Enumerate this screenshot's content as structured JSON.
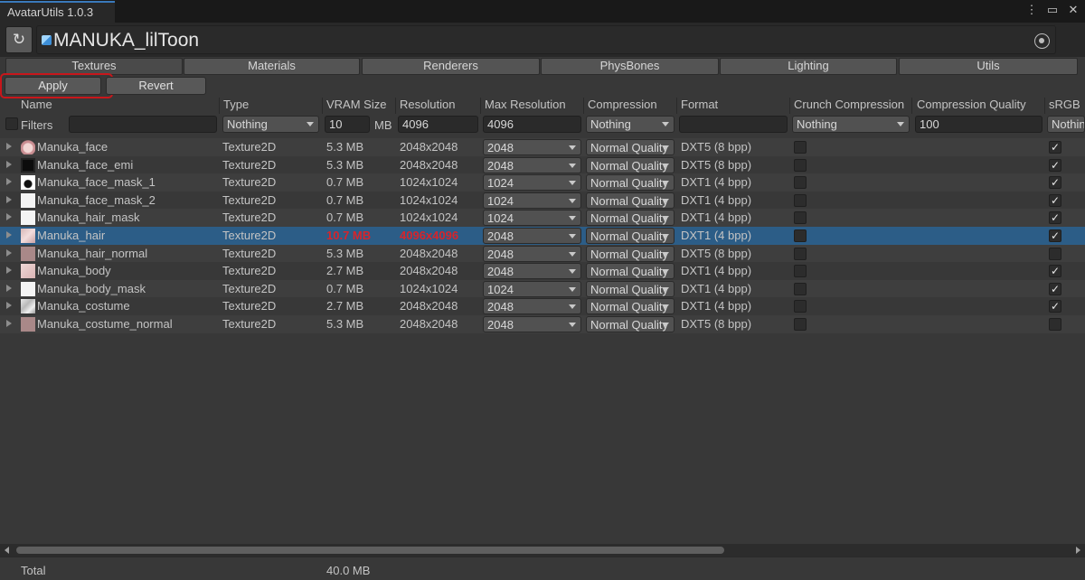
{
  "window": {
    "title": "AvatarUtils 1.0.3"
  },
  "avatar": {
    "name": "MANUKA_lilToon"
  },
  "tabs": [
    "Textures",
    "Materials",
    "Renderers",
    "PhysBones",
    "Lighting",
    "Utils"
  ],
  "actions": {
    "apply": "Apply",
    "revert": "Revert"
  },
  "columns": [
    "Name",
    "Type",
    "VRAM Size",
    "Resolution",
    "Max Resolution",
    "Compression",
    "Format",
    "Crunch Compression",
    "Compression Quality",
    "sRGB"
  ],
  "filters": {
    "label": "Filters",
    "name": "",
    "type": "Nothing",
    "vram": "10",
    "vram_unit": "MB",
    "resolution": "4096",
    "max_resolution": "4096",
    "compression": "Nothing",
    "format": "",
    "crunch": "Nothing",
    "quality": "100",
    "srgb": "Nothing"
  },
  "textures": [
    {
      "name": "Manuka_face",
      "type": "Texture2D",
      "vram": "5.3 MB",
      "resolution": "2048x2048",
      "max_resolution": "2048",
      "compression": "Normal Quality",
      "format": "DXT5 (8 bpp)",
      "crunch": false,
      "srgb": true,
      "thumb": "face"
    },
    {
      "name": "Manuka_face_emi",
      "type": "Texture2D",
      "vram": "5.3 MB",
      "resolution": "2048x2048",
      "max_resolution": "2048",
      "compression": "Normal Quality",
      "format": "DXT5 (8 bpp)",
      "crunch": false,
      "srgb": true,
      "thumb": "dark"
    },
    {
      "name": "Manuka_face_mask_1",
      "type": "Texture2D",
      "vram": "0.7 MB",
      "resolution": "1024x1024",
      "max_resolution": "1024",
      "compression": "Normal Quality",
      "format": "DXT1 (4 bpp)",
      "crunch": false,
      "srgb": true,
      "thumb": "mask"
    },
    {
      "name": "Manuka_face_mask_2",
      "type": "Texture2D",
      "vram": "0.7 MB",
      "resolution": "1024x1024",
      "max_resolution": "1024",
      "compression": "Normal Quality",
      "format": "DXT1 (4 bpp)",
      "crunch": false,
      "srgb": true,
      "thumb": "white"
    },
    {
      "name": "Manuka_hair_mask",
      "type": "Texture2D",
      "vram": "0.7 MB",
      "resolution": "1024x1024",
      "max_resolution": "1024",
      "compression": "Normal Quality",
      "format": "DXT1 (4 bpp)",
      "crunch": false,
      "srgb": true,
      "thumb": "white"
    },
    {
      "name": "Manuka_hair",
      "type": "Texture2D",
      "vram": "10.7 MB",
      "resolution": "4096x4096",
      "max_resolution": "2048",
      "compression": "Normal Quality",
      "format": "DXT1 (4 bpp)",
      "crunch": false,
      "srgb": true,
      "thumb": "pink",
      "warning": true,
      "selected": true
    },
    {
      "name": "Manuka_hair_normal",
      "type": "Texture2D",
      "vram": "5.3 MB",
      "resolution": "2048x2048",
      "max_resolution": "2048",
      "compression": "Normal Quality",
      "format": "DXT5 (8 bpp)",
      "crunch": false,
      "srgb": false,
      "thumb": "mauve"
    },
    {
      "name": "Manuka_body",
      "type": "Texture2D",
      "vram": "2.7 MB",
      "resolution": "2048x2048",
      "max_resolution": "2048",
      "compression": "Normal Quality",
      "format": "DXT1 (4 bpp)",
      "crunch": false,
      "srgb": true,
      "thumb": "skin"
    },
    {
      "name": "Manuka_body_mask",
      "type": "Texture2D",
      "vram": "0.7 MB",
      "resolution": "1024x1024",
      "max_resolution": "1024",
      "compression": "Normal Quality",
      "format": "DXT1 (4 bpp)",
      "crunch": false,
      "srgb": true,
      "thumb": "white"
    },
    {
      "name": "Manuka_costume",
      "type": "Texture2D",
      "vram": "2.7 MB",
      "resolution": "2048x2048",
      "max_resolution": "2048",
      "compression": "Normal Quality",
      "format": "DXT1 (4 bpp)",
      "crunch": false,
      "srgb": true,
      "thumb": "costume"
    },
    {
      "name": "Manuka_costume_normal",
      "type": "Texture2D",
      "vram": "5.3 MB",
      "resolution": "2048x2048",
      "max_resolution": "2048",
      "compression": "Normal Quality",
      "format": "DXT5 (8 bpp)",
      "crunch": false,
      "srgb": false,
      "thumb": "mauve"
    }
  ],
  "footer": {
    "label": "Total",
    "value": "40.0 MB"
  },
  "colors": {
    "warning": "#d6242b",
    "selection": "#2c5d87",
    "highlight_outline": "#c8161b",
    "tab_accent": "#3a79bb"
  },
  "icons": {
    "refresh": "refresh-icon",
    "menu": "kebab-menu-icon",
    "maximize": "maximize-icon",
    "close": "close-icon",
    "target": "object-picker-icon",
    "avatar": "prefab-cube-icon"
  }
}
